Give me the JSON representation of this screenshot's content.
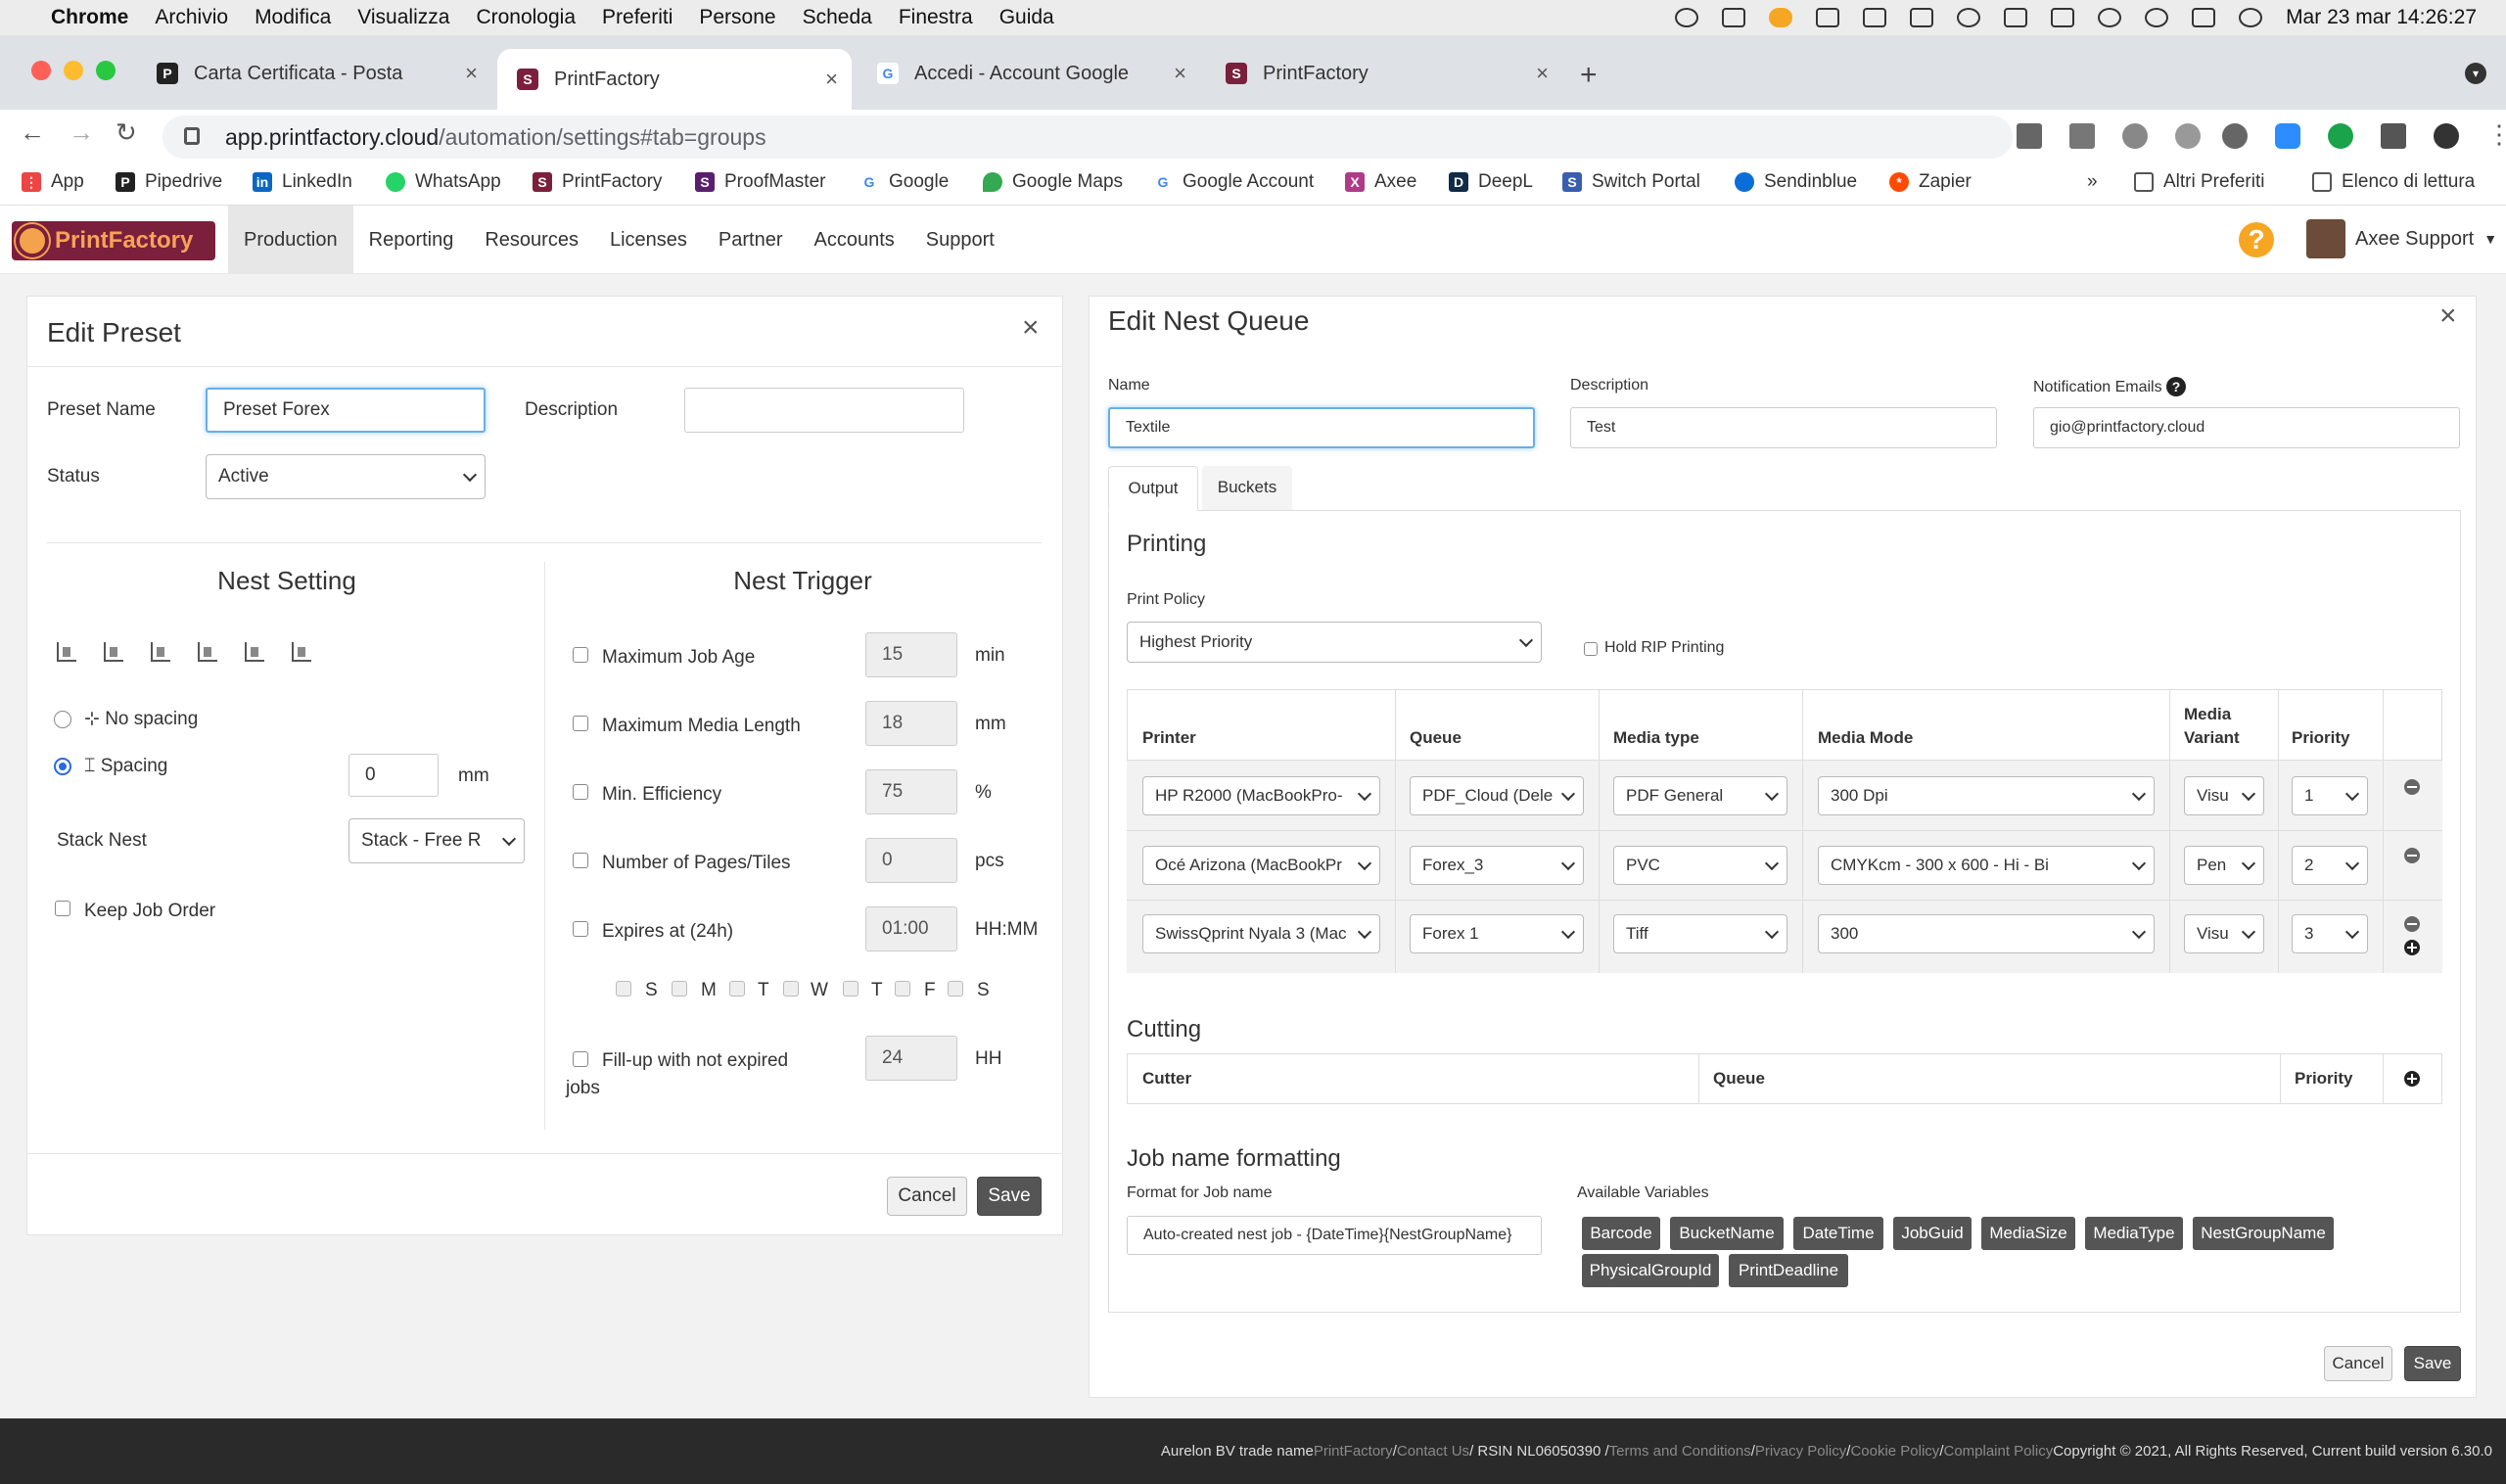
{
  "mac": {
    "apple": "",
    "menus": [
      "Chrome",
      "Archivio",
      "Modifica",
      "Visualizza",
      "Cronologia",
      "Preferiti",
      "Persone",
      "Scheda",
      "Finestra",
      "Guida"
    ],
    "clock": "Mar 23 mar  14:26:27"
  },
  "tabs": [
    {
      "title": "Carta Certificata - Posta",
      "icon": "P"
    },
    {
      "title": "PrintFactory",
      "icon": "S"
    },
    {
      "title": "Accedi - Account Google",
      "icon": "G"
    },
    {
      "title": "PrintFactory",
      "icon": "S"
    }
  ],
  "address": {
    "host": "app.printfactory.cloud",
    "path": "/automation/settings#tab=groups"
  },
  "bookmarks": [
    "App",
    "Pipedrive",
    "LinkedIn",
    "WhatsApp",
    "PrintFactory",
    "ProofMaster",
    "Google",
    "Google Maps",
    "Google Account",
    "Axee",
    "DeepL",
    "Switch Portal",
    "Sendinblue",
    "Zapier",
    "»",
    "Altri Preferiti",
    "Elenco di lettura"
  ],
  "appnav": {
    "logo": "PrintFactory",
    "items": [
      "Production",
      "Reporting",
      "Resources",
      "Licenses",
      "Partner",
      "Accounts",
      "Support"
    ],
    "help": "?",
    "user": "Axee Support"
  },
  "preset": {
    "title": "Edit Preset",
    "close": "×",
    "name_label": "Preset Name",
    "name_value": "Preset Forex",
    "desc_label": "Description",
    "desc_value": "",
    "status_label": "Status",
    "status_value": "Active",
    "nest_setting": "Nest Setting",
    "nest_trigger": "Nest Trigger",
    "no_spacing": "No spacing",
    "spacing": "Spacing",
    "spacing_value": "0",
    "spacing_unit": "mm",
    "stack_label": "Stack Nest",
    "stack_value": "Stack - Free R",
    "keep_order": "Keep Job Order",
    "triggers": [
      {
        "label": "Maximum Job Age",
        "value": "15",
        "unit": "min"
      },
      {
        "label": "Maximum Media Length",
        "value": "18",
        "unit": "mm"
      },
      {
        "label": "Min. Efficiency",
        "value": "75",
        "unit": "%"
      },
      {
        "label": "Number of Pages/Tiles",
        "value": "0",
        "unit": "pcs"
      },
      {
        "label": "Expires at (24h)",
        "value": "01:00",
        "unit": "HH:MM"
      }
    ],
    "days": [
      "S",
      "M",
      "T",
      "W",
      "T",
      "F",
      "S"
    ],
    "fillup_label1": "Fill-up with not expired",
    "fillup_label2": "jobs",
    "fillup_value": "24",
    "fillup_unit": "HH",
    "cancel": "Cancel",
    "save": "Save"
  },
  "queue": {
    "title": "Edit Nest Queue",
    "close": "×",
    "name_label": "Name",
    "name_value": "Textile",
    "desc_label": "Description",
    "desc_value": "Test",
    "notif_label": "Notification Emails",
    "notif_help": "?",
    "notif_value": "gio@printfactory.cloud",
    "tab_output": "Output",
    "tab_buckets": "Buckets",
    "printing": "Printing",
    "policy_label": "Print Policy",
    "policy_value": "Highest Priority",
    "hold_rip": "Hold RIP Printing",
    "headers": {
      "printer": "Printer",
      "queue": "Queue",
      "media_type": "Media type",
      "media_mode": "Media Mode",
      "variant1": "Media",
      "variant2": "Variant",
      "priority": "Priority"
    },
    "rows": [
      {
        "printer": "HP R2000 (MacBookPro-",
        "queue": "PDF_Cloud (Dele",
        "media_type": "PDF General",
        "media_mode": "300 Dpi",
        "variant": "Visu",
        "priority": "1"
      },
      {
        "printer": "Océ Arizona (MacBookPr",
        "queue": "Forex_3",
        "media_type": "PVC",
        "media_mode": "CMYKcm - 300 x 600 - Hi - Bi",
        "variant": "Pen",
        "priority": "2"
      },
      {
        "printer": "SwissQprint Nyala 3 (Mac",
        "queue": "Forex 1",
        "media_type": "Tiff",
        "media_mode": "300",
        "variant": "Visu",
        "priority": "3"
      }
    ],
    "cutting": "Cutting",
    "cut_headers": {
      "cutter": "Cutter",
      "queue": "Queue",
      "priority": "Priority"
    },
    "job_format": "Job name formatting",
    "format_label": "Format for Job name",
    "format_value": "Auto-created nest job - {DateTime}{NestGroupName}",
    "vars_label": "Available Variables",
    "vars": [
      "Barcode",
      "BucketName",
      "DateTime",
      "JobGuid",
      "MediaSize",
      "MediaType",
      "NestGroupName",
      "PhysicalGroupId",
      "PrintDeadline"
    ],
    "cancel": "Cancel",
    "save": "Save"
  },
  "footer": {
    "a": "Aurelon BV trade name ",
    "brand": "PrintFactory",
    "contact": "Contact Us",
    "rsin": " / RSIN NL06050390 / ",
    "terms": "Terms and Conditions",
    "privacy": "Privacy Policy",
    "cookie": "Cookie Policy",
    "complaint": "Complaint Policy",
    "sep": " / ",
    "copy": " Copyright © 2021, All Rights Reserved, Current build version 6.30.0"
  },
  "colors": {
    "accent_orange": "#f6a623",
    "logo_bg": "#7a1f3c",
    "focus": "#66afe9",
    "tag_bg": "#555555"
  }
}
